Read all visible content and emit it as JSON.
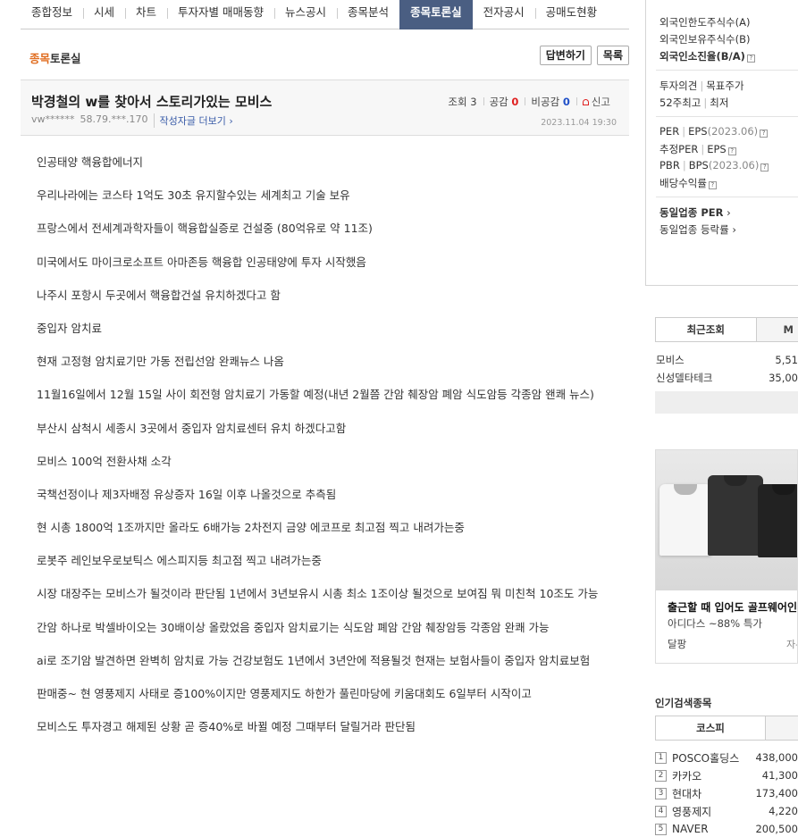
{
  "nav": {
    "tabs": [
      "종합정보",
      "시세",
      "차트",
      "투자자별 매매동향",
      "뉴스공시",
      "종목분석",
      "종목토론실",
      "전자공시",
      "공매도현황"
    ],
    "active_index": 6
  },
  "board": {
    "title_highlight": "종목",
    "title_rest": "토론실",
    "reply_button": "답변하기",
    "list_button": "목록"
  },
  "post": {
    "title": "박경철의 w를 찾아서 스토리가있는 모비스",
    "author": "vw******",
    "ip": "58.79.***.170",
    "more_posts": "작성자글 더보기",
    "views_label": "조회",
    "views": "3",
    "likes_label": "공감",
    "likes": "0",
    "dislikes_label": "비공감",
    "dislikes": "0",
    "report_label": "신고",
    "date": "2023.11.04 19:30",
    "body": [
      "인공태양 핵융합에너지",
      "우리나라에는 코스타 1억도 30초 유지할수있는 세계최고 기술 보유",
      "프랑스에서 전세계과학자들이 핵융합실증로 건설중 (80억유로 약 11조)",
      "미국에서도 마이크로소프트 아마존등 핵융합 인공태양에 투자 시작했음",
      "나주시 포항시 두곳에서 핵융합건설 유치하겠다고 함",
      "중입자 암치료",
      "현재 고정형 암치료기만 가동 전립선암 완쾌뉴스 나옴",
      "11월16일에서 12월 15일 사이 회전형 암치료기 가동할 예정(내년 2월쯤 간암 췌장암 폐암 식도암등 각종암 왠쾌 뉴스)",
      "부산시 삼척시 세종시 3곳에서 중입자 암치료센터 유치 하겠다고함",
      "모비스 100억 전환사채 소각",
      "국책선정이나 제3자배정 유상증자 16일 이후 나올것으로 추측됨",
      "현 시총 1800억 1조까지만 올라도 6배가능 2차전지 금양 에코프로 최고점 찍고 내려가는중",
      "로봇주 레인보우로보틱스 에스피지등 최고점 찍고 내려가는중",
      "시장 대장주는 모비스가 될것이라 판단됨 1년에서 3년보유시 시총 최소 1조이상 될것으로 보여짐 뭐 미친척 10조도 가능",
      "간암 하나로 박셀바이오는 30배이상 올랐었음 중입자 암치료기는 식도암 폐암 간암 췌장암등 각종암 완쾌 가능",
      "ai로 조기암 발견하면 완벽히 암치료 가능 건강보험도 1년에서 3년안에 적용될것 현재는 보험사들이 중입자 암치료보험",
      "판매중~ 현 영풍제지 사태로 증100%이지만 영풍제지도 하한가 풀린마당에 키움대회도 6일부터 시작이고",
      "모비스도 투자경고 해제된 상황 곧 증40%로 바뀔 예정 그때부터 달릴거라 판단됨"
    ]
  },
  "sidebar": {
    "foreign": {
      "limit": "외국인한도주식수(A)",
      "holding": "외국인보유주식수(B)",
      "ratio": "외국인소진율(B/A)"
    },
    "opinion": "투자의견",
    "target": "목표주가",
    "high52": "52주최고",
    "low": "최저",
    "per": "PER",
    "eps": "EPS",
    "eps_year": "(2023.06)",
    "est_per": "추정PER",
    "est_eps": "EPS",
    "pbr": "PBR",
    "bps": "BPS",
    "bps_year": "(2023.06)",
    "dividend": "배당수익률",
    "sector_per": "동일업종 PER",
    "sector_change": "동일업종 등락률",
    "recent_tab": "최근조회",
    "recent_tab2": "M",
    "recent": [
      {
        "name": "모비스",
        "value": "5,51"
      },
      {
        "name": "신성델타테크",
        "value": "35,00"
      }
    ],
    "ad": {
      "title": "출근할 때 입어도 골프웨어인",
      "subtitle": "아디다스 ~88% 특가",
      "shop": "달팡",
      "shop2": "자-"
    },
    "popular_title": "인기검색종목",
    "popular_tab": "코스피",
    "popular": [
      {
        "rank": "1",
        "name": "POSCO홀딩스",
        "value": "438,000"
      },
      {
        "rank": "2",
        "name": "카카오",
        "value": "41,300"
      },
      {
        "rank": "3",
        "name": "현대차",
        "value": "173,400"
      },
      {
        "rank": "4",
        "name": "영풍제지",
        "value": "4,220"
      },
      {
        "rank": "5",
        "name": "NAVER",
        "value": "200,500"
      }
    ]
  }
}
